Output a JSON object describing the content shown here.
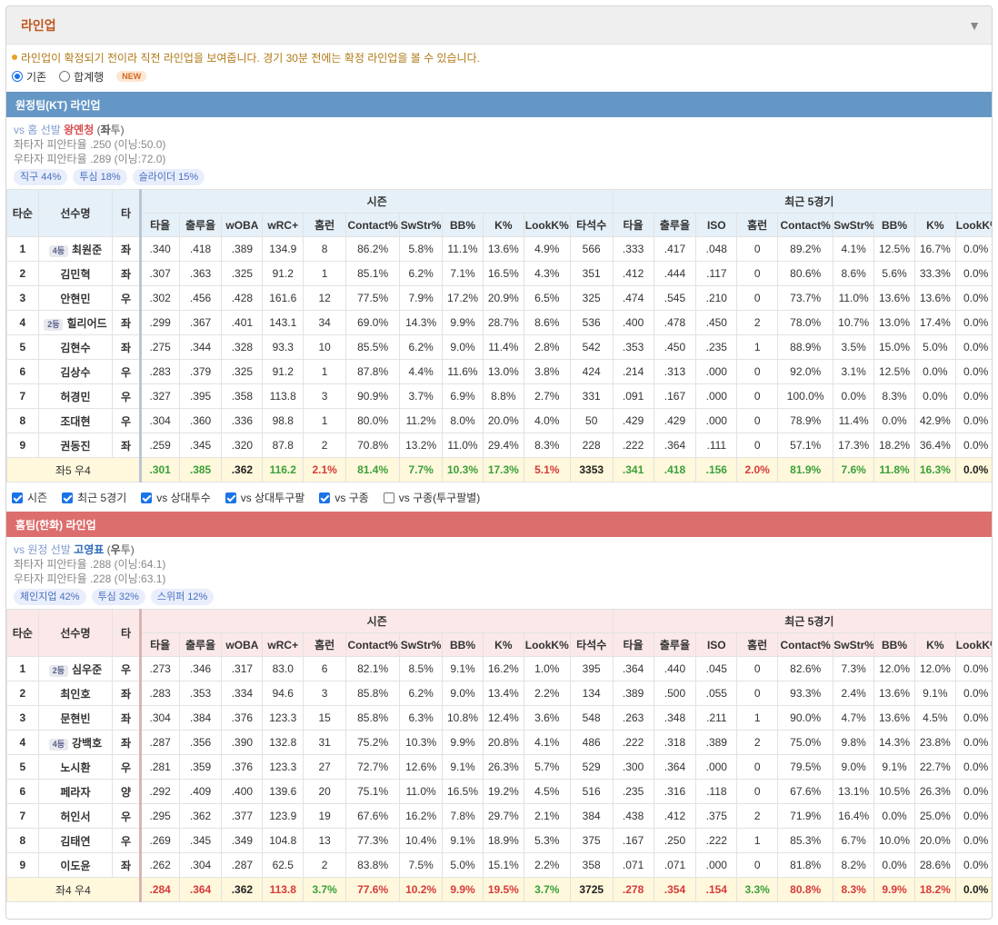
{
  "header": {
    "title": "라인업",
    "arrow": "▼"
  },
  "notice": "라인업이 확정되기 전이라 직전 라인업을 보여줍니다. 경기 30분 전에는 확정 라인업을 볼 수 있습니다.",
  "radios": [
    {
      "label": "기존",
      "checked": true
    },
    {
      "label": "합계행",
      "checked": false
    }
  ],
  "new_badge": "NEW",
  "col_headers": {
    "order": "타순",
    "name": "선수명",
    "hand": "타",
    "season": "시즌",
    "recent": "최근 5경기",
    "season_cols": [
      "타율",
      "출루율",
      "wOBA",
      "wRC+",
      "홈런",
      "Contact%",
      "SwStr%",
      "BB%",
      "K%",
      "LookK%",
      "타석수"
    ],
    "recent_cols": [
      "타율",
      "출루율",
      "ISO",
      "홈런",
      "Contact%",
      "SwStr%",
      "BB%",
      "K%",
      "LookK%"
    ]
  },
  "away": {
    "bar": "원정팀(KT) 라인업",
    "vs": "vs 홈 선발 ",
    "pitcher": "왕옌청",
    "hand_open": " (",
    "hand": "좌",
    "hand_close": "투)",
    "lhb": "좌타자 피안타율 .250 (이닝:50.0)",
    "rhb": "우타자 피안타율 .289 (이닝:72.0)",
    "pills": [
      "직구 44%",
      "투심 18%",
      "슬라이더 15%"
    ],
    "rows": [
      [
        "1",
        "4등",
        "최원준",
        "좌",
        ".340",
        ".418",
        ".389",
        "134.9",
        "8",
        "86.2%",
        "5.8%",
        "11.1%",
        "13.6%",
        "4.9%",
        "566",
        ".333",
        ".417",
        ".048",
        "0",
        "89.2%",
        "4.1%",
        "12.5%",
        "16.7%",
        "0.0%"
      ],
      [
        "2",
        "",
        "김민혁",
        "좌",
        ".307",
        ".363",
        ".325",
        "91.2",
        "1",
        "85.1%",
        "6.2%",
        "7.1%",
        "16.5%",
        "4.3%",
        "351",
        ".412",
        ".444",
        ".117",
        "0",
        "80.6%",
        "8.6%",
        "5.6%",
        "33.3%",
        "0.0%"
      ],
      [
        "3",
        "",
        "안현민",
        "우",
        ".302",
        ".456",
        ".428",
        "161.6",
        "12",
        "77.5%",
        "7.9%",
        "17.2%",
        "20.9%",
        "6.5%",
        "325",
        ".474",
        ".545",
        ".210",
        "0",
        "73.7%",
        "11.0%",
        "13.6%",
        "13.6%",
        "0.0%"
      ],
      [
        "4",
        "2등",
        "힐리어드",
        "좌",
        ".299",
        ".367",
        ".401",
        "143.1",
        "34",
        "69.0%",
        "14.3%",
        "9.9%",
        "28.7%",
        "8.6%",
        "536",
        ".400",
        ".478",
        ".450",
        "2",
        "78.0%",
        "10.7%",
        "13.0%",
        "17.4%",
        "0.0%"
      ],
      [
        "5",
        "",
        "김현수",
        "좌",
        ".275",
        ".344",
        ".328",
        "93.3",
        "10",
        "85.5%",
        "6.2%",
        "9.0%",
        "11.4%",
        "2.8%",
        "542",
        ".353",
        ".450",
        ".235",
        "1",
        "88.9%",
        "3.5%",
        "15.0%",
        "5.0%",
        "0.0%"
      ],
      [
        "6",
        "",
        "김상수",
        "우",
        ".283",
        ".379",
        ".325",
        "91.2",
        "1",
        "87.8%",
        "4.4%",
        "11.6%",
        "13.0%",
        "3.8%",
        "424",
        ".214",
        ".313",
        ".000",
        "0",
        "92.0%",
        "3.1%",
        "12.5%",
        "0.0%",
        "0.0%"
      ],
      [
        "7",
        "",
        "허경민",
        "우",
        ".327",
        ".395",
        ".358",
        "113.8",
        "3",
        "90.9%",
        "3.7%",
        "6.9%",
        "8.8%",
        "2.7%",
        "331",
        ".091",
        ".167",
        ".000",
        "0",
        "100.0%",
        "0.0%",
        "8.3%",
        "0.0%",
        "0.0%"
      ],
      [
        "8",
        "",
        "조대현",
        "우",
        ".304",
        ".360",
        ".336",
        "98.8",
        "1",
        "80.0%",
        "11.2%",
        "8.0%",
        "20.0%",
        "4.0%",
        "50",
        ".429",
        ".429",
        ".000",
        "0",
        "78.9%",
        "11.4%",
        "0.0%",
        "42.9%",
        "0.0%"
      ],
      [
        "9",
        "",
        "권동진",
        "좌",
        ".259",
        ".345",
        ".320",
        "87.8",
        "2",
        "70.8%",
        "13.2%",
        "11.0%",
        "29.4%",
        "8.3%",
        "228",
        ".222",
        ".364",
        ".111",
        "0",
        "57.1%",
        "17.3%",
        "18.2%",
        "36.4%",
        "0.0%"
      ]
    ],
    "total": {
      "label": "좌5 우4",
      "vals": [
        ".301",
        ".385",
        ".362",
        "116.2",
        "2.1%",
        "81.4%",
        "7.7%",
        "10.3%",
        "17.3%",
        "5.1%",
        "3353",
        ".341",
        ".418",
        ".156",
        "2.0%",
        "81.9%",
        "7.6%",
        "11.8%",
        "16.3%",
        "0.0%"
      ],
      "colors": [
        "g",
        "g",
        "k",
        "g",
        "r",
        "g",
        "g",
        "g",
        "g",
        "r",
        "k",
        "g",
        "g",
        "g",
        "r",
        "g",
        "g",
        "g",
        "g",
        "k"
      ]
    }
  },
  "checks": [
    {
      "label": "시즌",
      "on": true
    },
    {
      "label": "최근 5경기",
      "on": true
    },
    {
      "label": "vs 상대투수",
      "on": true
    },
    {
      "label": "vs 상대투구팔",
      "on": true
    },
    {
      "label": "vs 구종",
      "on": true
    },
    {
      "label": "vs 구종(투구팔별)",
      "on": false
    }
  ],
  "home": {
    "bar": "홈팀(한화) 라인업",
    "vs": "vs 원정 선발 ",
    "pitcher": "고영표",
    "hand_open": " (",
    "hand": "우",
    "hand_close": "투)",
    "lhb": "좌타자 피안타율 .288 (이닝:64.1)",
    "rhb": "우타자 피안타율 .228 (이닝:63.1)",
    "pills": [
      "체인지업 42%",
      "투심 32%",
      "스위퍼 12%"
    ],
    "rows": [
      [
        "1",
        "2등",
        "심우준",
        "우",
        ".273",
        ".346",
        ".317",
        "83.0",
        "6",
        "82.1%",
        "8.5%",
        "9.1%",
        "16.2%",
        "1.0%",
        "395",
        ".364",
        ".440",
        ".045",
        "0",
        "82.6%",
        "7.3%",
        "12.0%",
        "12.0%",
        "0.0%"
      ],
      [
        "2",
        "",
        "최인호",
        "좌",
        ".283",
        ".353",
        ".334",
        "94.6",
        "3",
        "85.8%",
        "6.2%",
        "9.0%",
        "13.4%",
        "2.2%",
        "134",
        ".389",
        ".500",
        ".055",
        "0",
        "93.3%",
        "2.4%",
        "13.6%",
        "9.1%",
        "0.0%"
      ],
      [
        "3",
        "",
        "문현빈",
        "좌",
        ".304",
        ".384",
        ".376",
        "123.3",
        "15",
        "85.8%",
        "6.3%",
        "10.8%",
        "12.4%",
        "3.6%",
        "548",
        ".263",
        ".348",
        ".211",
        "1",
        "90.0%",
        "4.7%",
        "13.6%",
        "4.5%",
        "0.0%"
      ],
      [
        "4",
        "4등",
        "강백호",
        "좌",
        ".287",
        ".356",
        ".390",
        "132.8",
        "31",
        "75.2%",
        "10.3%",
        "9.9%",
        "20.8%",
        "4.1%",
        "486",
        ".222",
        ".318",
        ".389",
        "2",
        "75.0%",
        "9.8%",
        "14.3%",
        "23.8%",
        "0.0%"
      ],
      [
        "5",
        "",
        "노시환",
        "우",
        ".281",
        ".359",
        ".376",
        "123.3",
        "27",
        "72.7%",
        "12.6%",
        "9.1%",
        "26.3%",
        "5.7%",
        "529",
        ".300",
        ".364",
        ".000",
        "0",
        "79.5%",
        "9.0%",
        "9.1%",
        "22.7%",
        "0.0%"
      ],
      [
        "6",
        "",
        "페라자",
        "양",
        ".292",
        ".409",
        ".400",
        "139.6",
        "20",
        "75.1%",
        "11.0%",
        "16.5%",
        "19.2%",
        "4.5%",
        "516",
        ".235",
        ".316",
        ".118",
        "0",
        "67.6%",
        "13.1%",
        "10.5%",
        "26.3%",
        "0.0%"
      ],
      [
        "7",
        "",
        "허인서",
        "우",
        ".295",
        ".362",
        ".377",
        "123.9",
        "19",
        "67.6%",
        "16.2%",
        "7.8%",
        "29.7%",
        "2.1%",
        "384",
        ".438",
        ".412",
        ".375",
        "2",
        "71.9%",
        "16.4%",
        "0.0%",
        "25.0%",
        "0.0%"
      ],
      [
        "8",
        "",
        "김태연",
        "우",
        ".269",
        ".345",
        ".349",
        "104.8",
        "13",
        "77.3%",
        "10.4%",
        "9.1%",
        "18.9%",
        "5.3%",
        "375",
        ".167",
        ".250",
        ".222",
        "1",
        "85.3%",
        "6.7%",
        "10.0%",
        "20.0%",
        "0.0%"
      ],
      [
        "9",
        "",
        "이도윤",
        "좌",
        ".262",
        ".304",
        ".287",
        "62.5",
        "2",
        "83.8%",
        "7.5%",
        "5.0%",
        "15.1%",
        "2.2%",
        "358",
        ".071",
        ".071",
        ".000",
        "0",
        "81.8%",
        "8.2%",
        "0.0%",
        "28.6%",
        "0.0%"
      ]
    ],
    "total": {
      "label": "좌4 우4",
      "vals": [
        ".284",
        ".364",
        ".362",
        "113.8",
        "3.7%",
        "77.6%",
        "10.2%",
        "9.9%",
        "19.5%",
        "3.7%",
        "3725",
        ".278",
        ".354",
        ".154",
        "3.3%",
        "80.8%",
        "8.3%",
        "9.9%",
        "18.2%",
        "0.0%"
      ],
      "colors": [
        "r",
        "r",
        "k",
        "r",
        "g",
        "r",
        "r",
        "r",
        "r",
        "g",
        "k",
        "r",
        "r",
        "r",
        "g",
        "r",
        "r",
        "r",
        "r",
        "k"
      ]
    }
  }
}
